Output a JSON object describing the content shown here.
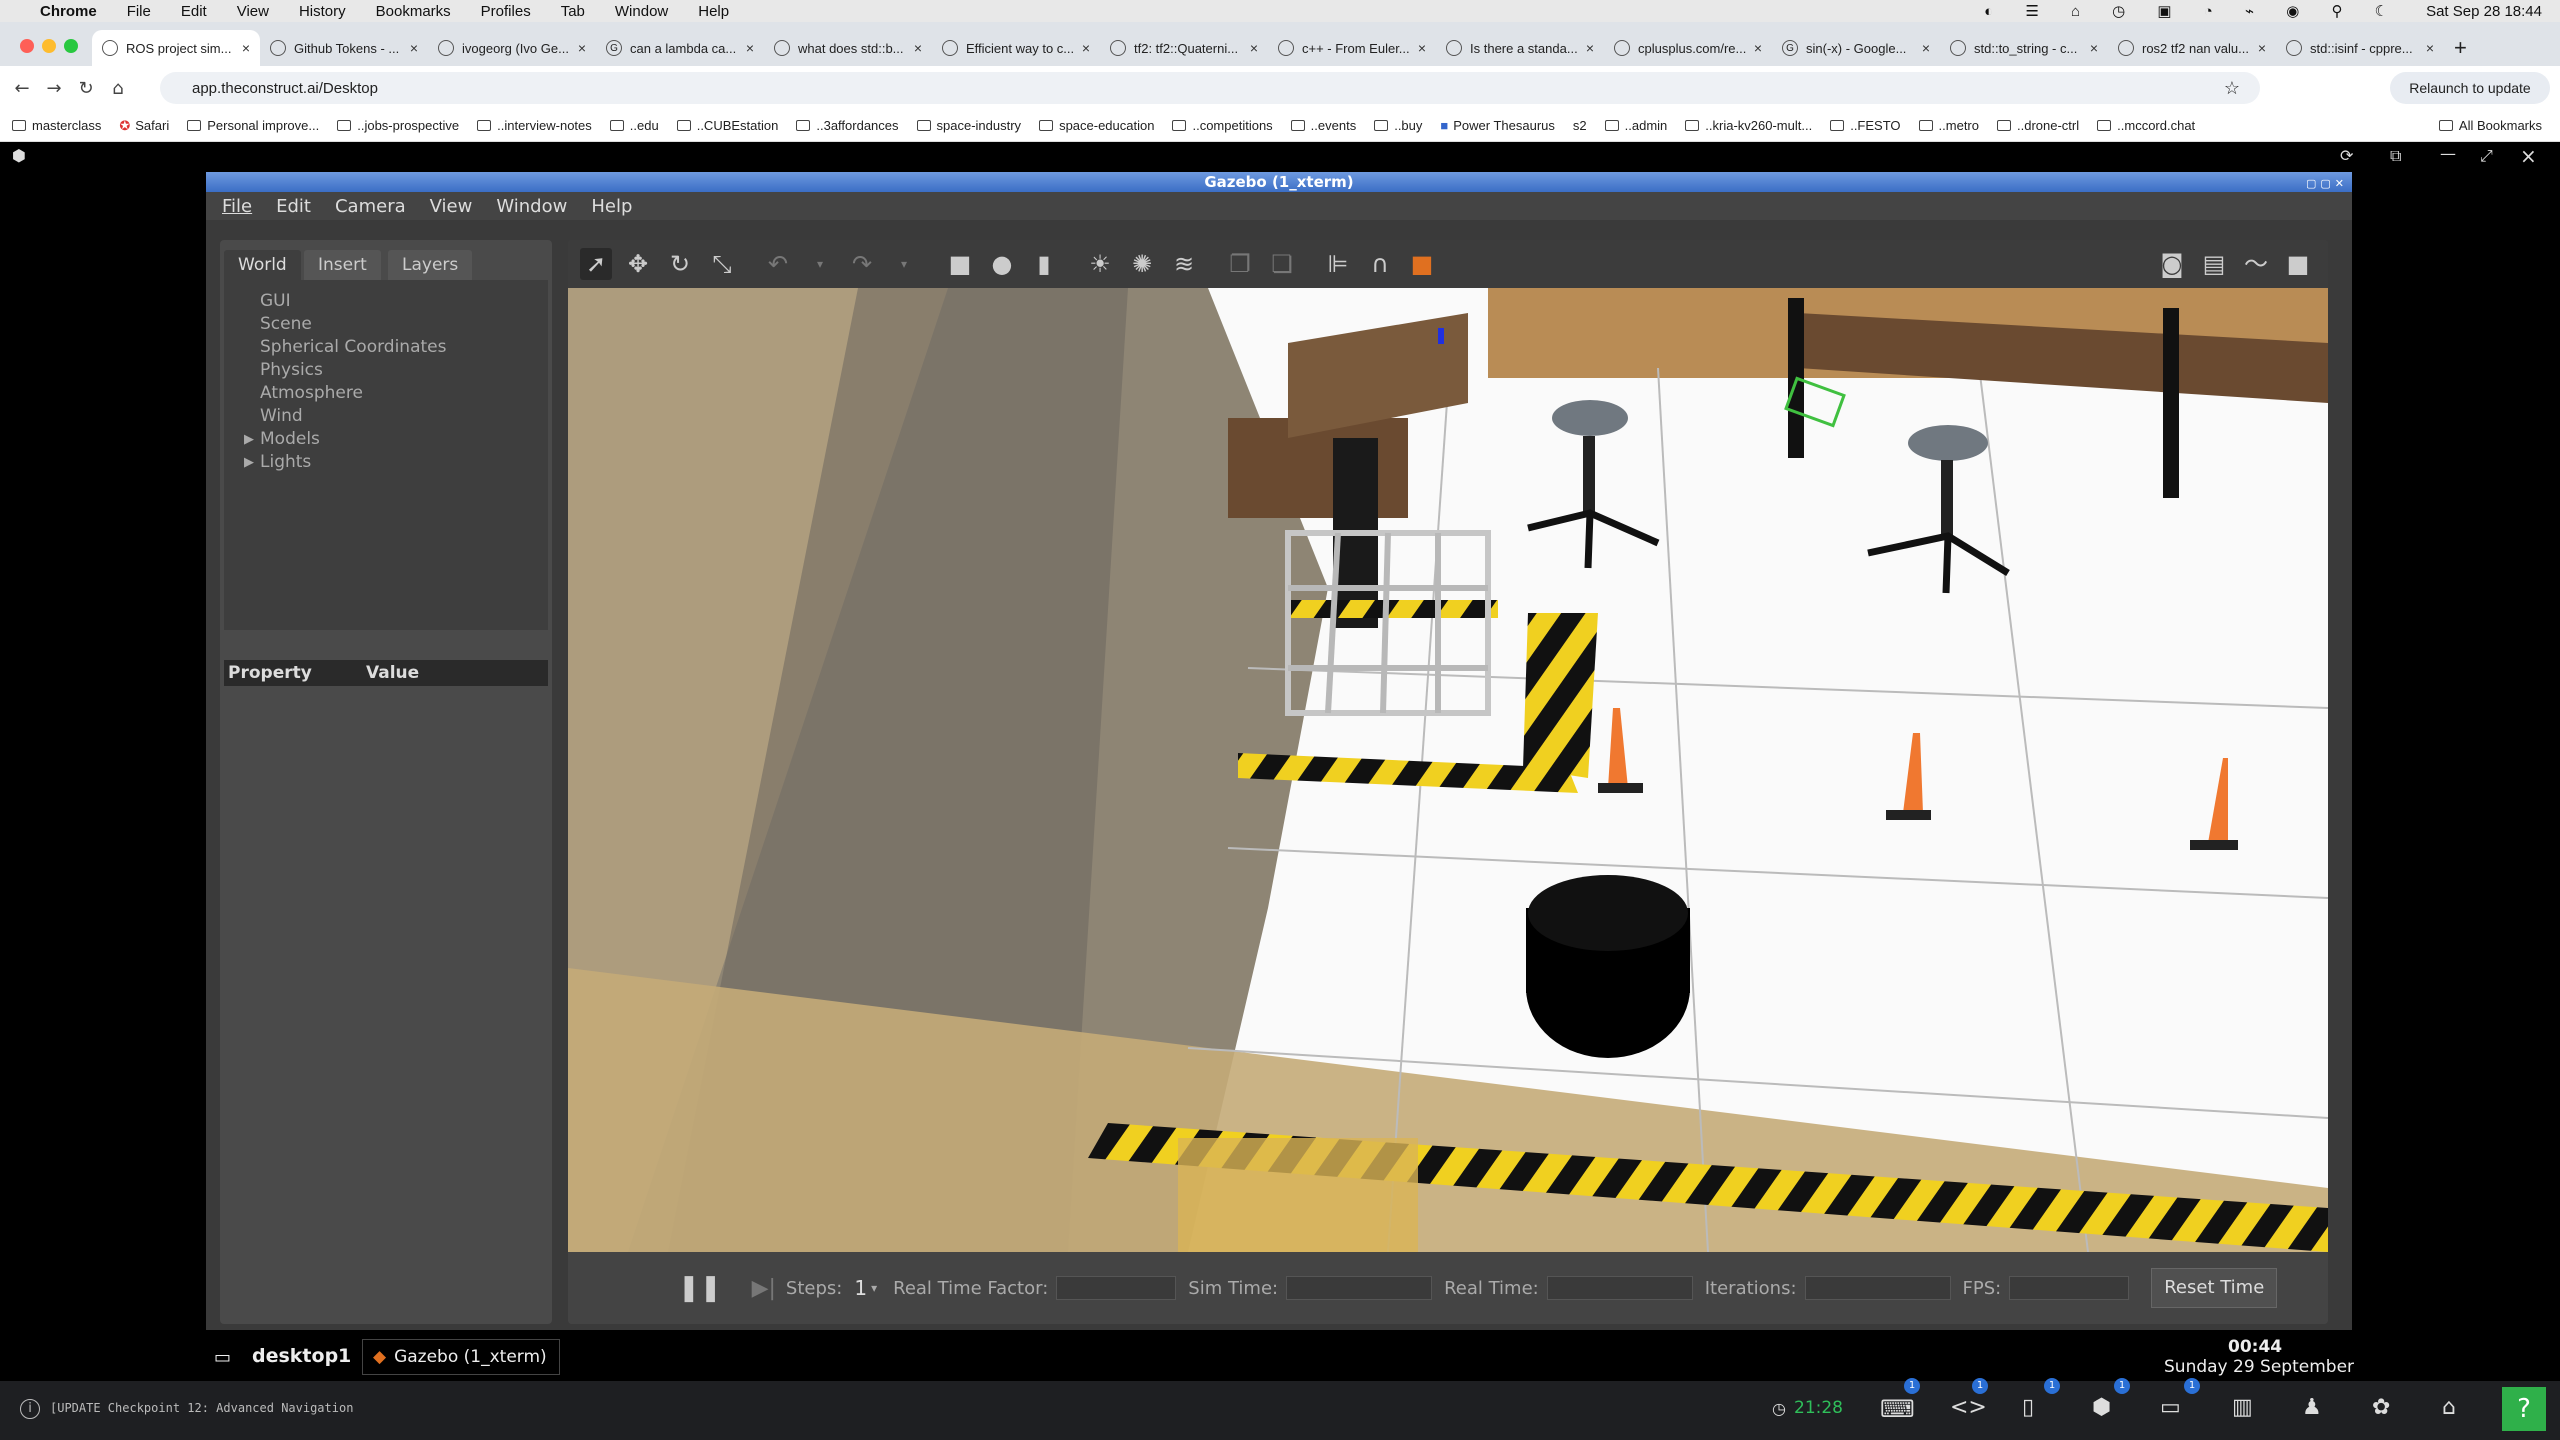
{
  "mac": {
    "app": "Chrome",
    "menus": [
      "File",
      "Edit",
      "View",
      "History",
      "Bookmarks",
      "Profiles",
      "Tab",
      "Window",
      "Help"
    ],
    "datetime": "Sat Sep 28  18:44"
  },
  "tabs": [
    "ROS project sim...",
    "Github Tokens - ...",
    "ivogeorg (Ivo Ge...",
    "can a lambda ca...",
    "what does std::b...",
    "Efficient way to c...",
    "tf2: tf2::Quaterni...",
    "c++ - From Euler...",
    "Is there a standa...",
    "cplusplus.com/re...",
    "sin(-x) - Google...",
    "std::to_string - c...",
    "ros2 tf2 nan valu...",
    "std::isinf - cppre..."
  ],
  "address": {
    "url": "app.theconstruct.ai/Desktop",
    "relaunch": "Relaunch to update"
  },
  "bookmarks": [
    "masterclass",
    "Safari",
    "Personal improve...",
    "..jobs-prospective",
    "..interview-notes",
    "..edu",
    "..CUBEstation",
    "..3affordances",
    "space-industry",
    "space-education",
    "..competitions",
    "..events",
    "..buy",
    "Power Thesaurus",
    "s2",
    "..admin",
    "..kria-kv260-mult...",
    "..FESTO",
    "..metro",
    "..drone-ctrl",
    "..mccord.chat"
  ],
  "bookmarks_all": "All Bookmarks",
  "gazebo": {
    "title": "Gazebo (1_xterm)",
    "menu": [
      "File",
      "Edit",
      "Camera",
      "View",
      "Window",
      "Help"
    ],
    "left_tabs": [
      "World",
      "Insert",
      "Layers"
    ],
    "tree": [
      "GUI",
      "Scene",
      "Spherical Coordinates",
      "Physics",
      "Atmosphere",
      "Wind",
      "Models",
      "Lights"
    ],
    "prop_headers": [
      "Property",
      "Value"
    ],
    "bottom": {
      "steps_label": "Steps:",
      "steps_value": "1",
      "rtf": "Real Time Factor:",
      "sim": "Sim Time:",
      "real": "Real Time:",
      "iter": "Iterations:",
      "fps": "FPS:",
      "reset": "Reset Time"
    }
  },
  "taskbar": {
    "desktop": "desktop",
    "desktop_num": "1",
    "app": "Gazebo (1_xterm)",
    "time": "00:44",
    "date": "Sunday 29 September"
  },
  "status": {
    "update": "[UPDATE Checkpoint 12: Advanced Navigation",
    "timer": "21:28",
    "badge": "1"
  }
}
